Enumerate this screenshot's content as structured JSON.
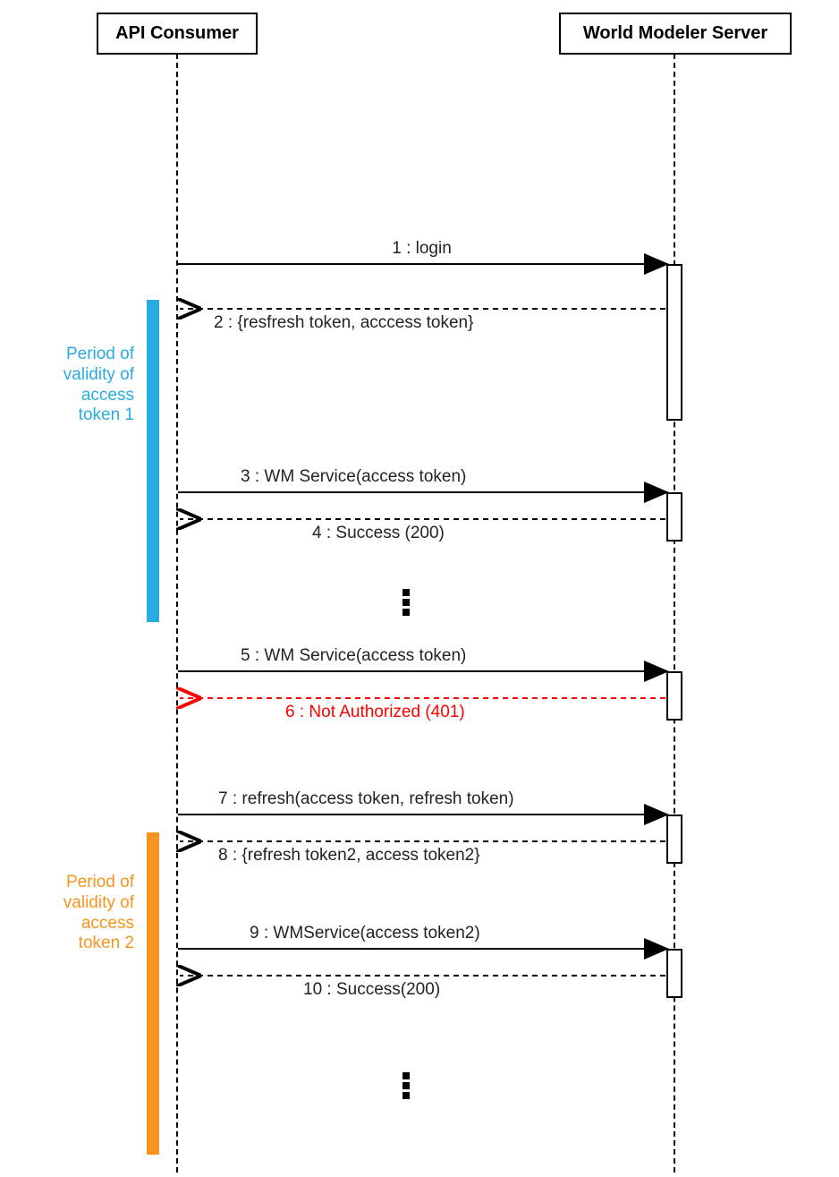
{
  "participants": {
    "consumer": "API Consumer",
    "server": "World Modeler Server"
  },
  "periods": {
    "p1": {
      "lines": [
        "Period of",
        "validity of",
        "access",
        "token 1"
      ],
      "color": "#29ABE2"
    },
    "p2": {
      "lines": [
        "Period of",
        "validity of",
        "access",
        "token 2"
      ],
      "color": "#F7931E"
    }
  },
  "messages": {
    "m1": {
      "num": "1",
      "text": "login",
      "dir": "req",
      "style": "solid",
      "color": "#000"
    },
    "m2": {
      "num": "2",
      "text": "{resfresh token, acccess token}",
      "dir": "resp",
      "style": "dashed",
      "color": "#000"
    },
    "m3": {
      "num": "3",
      "text": "WM Service(access token)",
      "dir": "req",
      "style": "solid",
      "color": "#000"
    },
    "m4": {
      "num": "4",
      "text": "Success (200)",
      "dir": "resp",
      "style": "dashed",
      "color": "#000"
    },
    "m5": {
      "num": "5",
      "text": "WM Service(access token)",
      "dir": "req",
      "style": "solid",
      "color": "#000"
    },
    "m6": {
      "num": "6",
      "text": "Not  Authorized (401)",
      "dir": "resp",
      "style": "dashed",
      "color": "#FF0000"
    },
    "m7": {
      "num": "7",
      "text": "refresh(access token, refresh token)",
      "dir": "req",
      "style": "solid",
      "color": "#000"
    },
    "m8": {
      "num": "8",
      "text": "{refresh token2, access token2}",
      "dir": "resp",
      "style": "dashed",
      "color": "#000"
    },
    "m9": {
      "num": "9",
      "text": "WMService(access token2)",
      "dir": "req",
      "style": "solid",
      "color": "#000"
    },
    "m10": {
      "num": "10",
      "text": "Success(200)",
      "dir": "resp",
      "style": "dashed",
      "color": "#000"
    }
  },
  "chart_data": {
    "type": "sequence-diagram",
    "participants": [
      "API Consumer",
      "World Modeler Server"
    ],
    "messages": [
      {
        "n": 1,
        "from": "API Consumer",
        "to": "World Modeler Server",
        "label": "login",
        "kind": "sync"
      },
      {
        "n": 2,
        "from": "World Modeler Server",
        "to": "API Consumer",
        "label": "{resfresh token, acccess token}",
        "kind": "return"
      },
      {
        "n": 3,
        "from": "API Consumer",
        "to": "World Modeler Server",
        "label": "WM Service(access token)",
        "kind": "sync"
      },
      {
        "n": 4,
        "from": "World Modeler Server",
        "to": "API Consumer",
        "label": "Success (200)",
        "kind": "return"
      },
      {
        "n": 5,
        "from": "API Consumer",
        "to": "World Modeler Server",
        "label": "WM Service(access token)",
        "kind": "sync"
      },
      {
        "n": 6,
        "from": "World Modeler Server",
        "to": "API Consumer",
        "label": "Not  Authorized (401)",
        "kind": "return",
        "status": "error"
      },
      {
        "n": 7,
        "from": "API Consumer",
        "to": "World Modeler Server",
        "label": "refresh(access token, refresh token)",
        "kind": "sync"
      },
      {
        "n": 8,
        "from": "World Modeler Server",
        "to": "API Consumer",
        "label": "{refresh token2, access token2}",
        "kind": "return"
      },
      {
        "n": 9,
        "from": "API Consumer",
        "to": "World Modeler Server",
        "label": "WMService(access token2)",
        "kind": "sync"
      },
      {
        "n": 10,
        "from": "World Modeler Server",
        "to": "API Consumer",
        "label": "Success(200)",
        "kind": "return"
      }
    ],
    "validity_periods": [
      {
        "name": "Period of validity of access token 1",
        "color": "#29ABE2",
        "covers_messages": [
          2,
          3,
          4
        ]
      },
      {
        "name": "Period of validity of access token 2",
        "color": "#F7931E",
        "covers_messages": [
          8,
          9,
          10
        ]
      }
    ]
  }
}
